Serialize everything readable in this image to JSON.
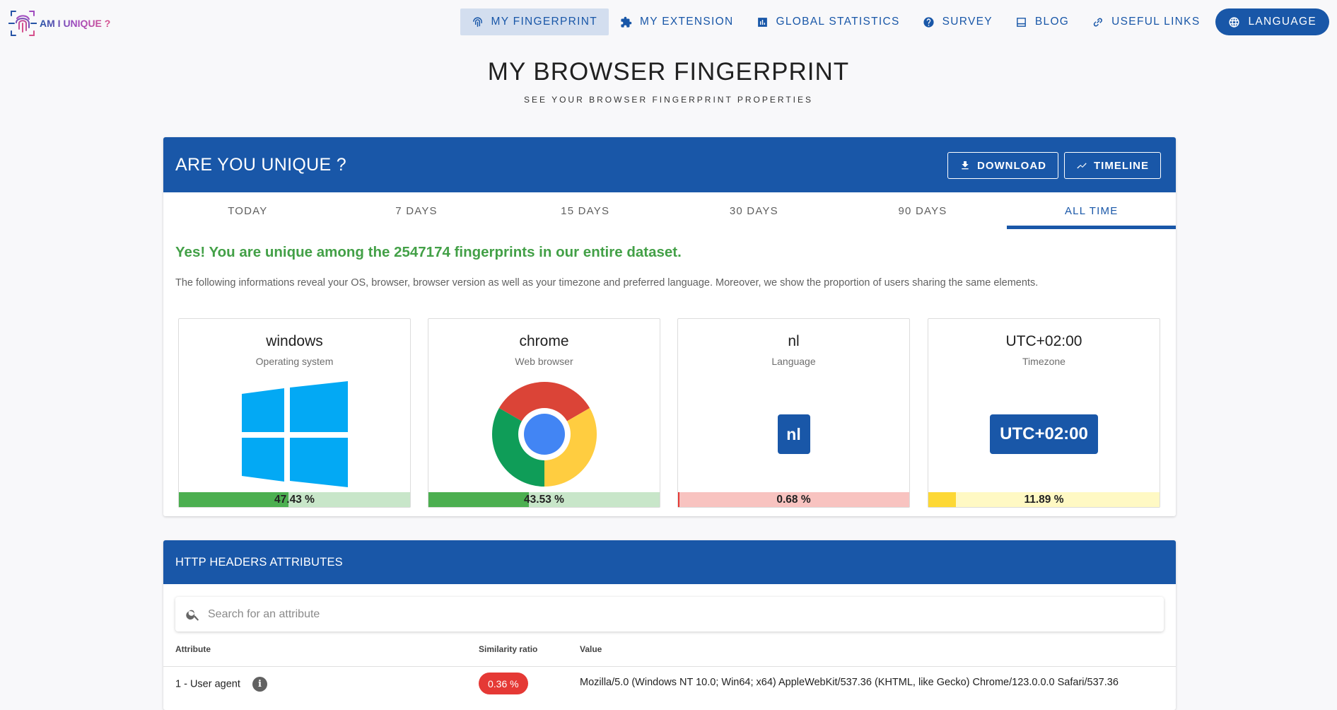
{
  "brand": {
    "name": "AM I UNIQUE ?"
  },
  "nav": {
    "items": [
      {
        "label": "MY FINGERPRINT",
        "icon": "fingerprint-icon",
        "active": true
      },
      {
        "label": "MY EXTENSION",
        "icon": "puzzle-icon"
      },
      {
        "label": "GLOBAL STATISTICS",
        "icon": "bar-chart-icon"
      },
      {
        "label": "SURVEY",
        "icon": "help-circle-icon"
      },
      {
        "label": "BLOG",
        "icon": "blog-icon"
      },
      {
        "label": "USEFUL LINKS",
        "icon": "link-icon"
      }
    ],
    "language": {
      "label": "LANGUAGE",
      "icon": "globe-icon"
    }
  },
  "page": {
    "title": "MY BROWSER FINGERPRINT",
    "subtitle": "SEE YOUR BROWSER FINGERPRINT PROPERTIES"
  },
  "unique_card": {
    "title": "ARE YOU UNIQUE ?",
    "download_label": "DOWNLOAD",
    "timeline_label": "TIMELINE",
    "tabs": [
      "TODAY",
      "7 DAYS",
      "15 DAYS",
      "30 DAYS",
      "90 DAYS",
      "ALL TIME"
    ],
    "active_tab": "ALL TIME",
    "message": "Yes! You are unique among the 2547174 fingerprints in our entire dataset.",
    "info": "The following informations reveal your OS, browser, browser version as well as your timezone and preferred language. Moreover, we show the proportion of users sharing the same elements.",
    "stats": [
      {
        "value": "windows",
        "label": "Operating system",
        "percent_text": "47.43 %",
        "percent": 47.43,
        "bar_color": "#4caf50",
        "track_color": "#c8e6c9",
        "visual": "windows-logo-icon"
      },
      {
        "value": "chrome",
        "label": "Web browser",
        "percent_text": "43.53 %",
        "percent": 43.53,
        "bar_color": "#4caf50",
        "track_color": "#c8e6c9",
        "visual": "chrome-logo-icon"
      },
      {
        "value": "nl",
        "label": "Language",
        "percent_text": "0.68 %",
        "percent": 0.68,
        "bar_color": "#e53935",
        "track_color": "#f8c3c0",
        "badge": "nl"
      },
      {
        "value": "UTC+02:00",
        "label": "Timezone",
        "percent_text": "11.89 %",
        "percent": 11.89,
        "bar_color": "#fdd835",
        "track_color": "#fff9c4",
        "badge": "UTC+02:00"
      }
    ]
  },
  "http_card": {
    "title": "HTTP HEADERS ATTRIBUTES",
    "search_placeholder": "Search for an attribute",
    "columns": [
      "Attribute",
      "Similarity ratio",
      "Value"
    ],
    "rows": [
      {
        "attribute": "1 - User agent",
        "ratio": "0.36 %",
        "value": "Mozilla/5.0 (Windows NT 10.0; Win64; x64) AppleWebKit/537.36 (KHTML, like Gecko) Chrome/123.0.0.0 Safari/537.36"
      }
    ]
  }
}
